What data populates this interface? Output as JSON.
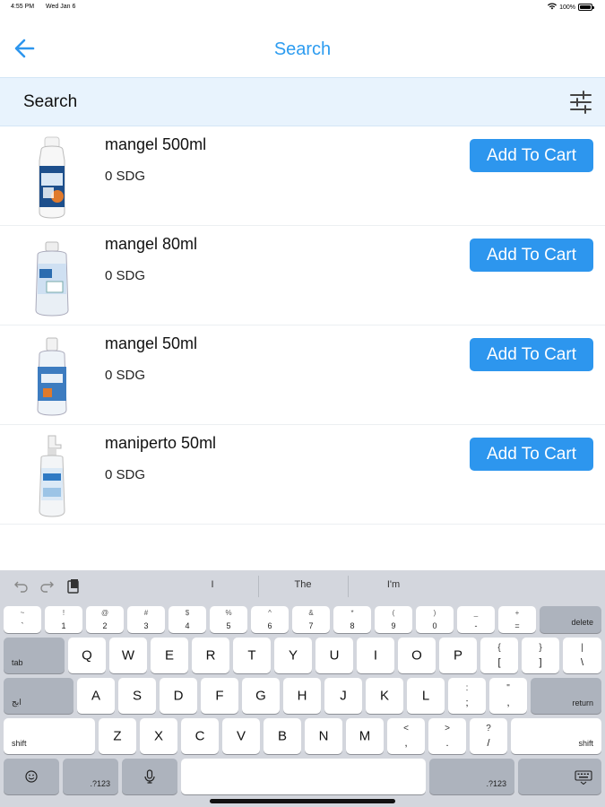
{
  "status_bar": {
    "time": "4:55 PM",
    "date": "Wed Jan 6",
    "battery": "100%"
  },
  "nav": {
    "title": "Search",
    "back_icon": "arrow-left-icon"
  },
  "search": {
    "placeholder": "Search",
    "value": "",
    "filter_icon": "sliders-icon"
  },
  "accent_color": "#2d96ee",
  "products": [
    {
      "name": "mangel 500ml",
      "price": "0 SDG",
      "button": "Add To Cart"
    },
    {
      "name": "mangel 80ml",
      "price": "0 SDG",
      "button": "Add To Cart"
    },
    {
      "name": "mangel 50ml",
      "price": "0 SDG",
      "button": "Add To Cart"
    },
    {
      "name": "maniperto 50ml",
      "price": "0 SDG",
      "button": "Add To Cart"
    }
  ],
  "keyboard": {
    "suggestions": [
      "I",
      "The",
      "I'm"
    ],
    "number_row": [
      {
        "top": "~",
        "bottom": "`"
      },
      {
        "top": "!",
        "bottom": "1"
      },
      {
        "top": "@",
        "bottom": "2"
      },
      {
        "top": "#",
        "bottom": "3"
      },
      {
        "top": "$",
        "bottom": "4"
      },
      {
        "top": "%",
        "bottom": "5"
      },
      {
        "top": "^",
        "bottom": "6"
      },
      {
        "top": "&",
        "bottom": "7"
      },
      {
        "top": "*",
        "bottom": "8"
      },
      {
        "top": "(",
        "bottom": "9"
      },
      {
        "top": ")",
        "bottom": "0"
      },
      {
        "top": "_",
        "bottom": "-"
      },
      {
        "top": "+",
        "bottom": "="
      }
    ],
    "delete": "delete",
    "tab": "tab",
    "row_q": [
      "Q",
      "W",
      "E",
      "R",
      "T",
      "Y",
      "U",
      "I",
      "O",
      "P"
    ],
    "row_q_sym": [
      {
        "top": "{",
        "bottom": "["
      },
      {
        "top": "}",
        "bottom": "]"
      },
      {
        "top": "|",
        "bottom": "\\"
      }
    ],
    "lang": "ابج",
    "row_a": [
      "A",
      "S",
      "D",
      "F",
      "G",
      "H",
      "J",
      "K",
      "L"
    ],
    "row_a_sym": [
      {
        "top": ":",
        "bottom": ";"
      },
      {
        "top": "\"",
        "bottom": ","
      }
    ],
    "return": "return",
    "shift": "shift",
    "row_z": [
      "Z",
      "X",
      "C",
      "V",
      "B",
      "N",
      "M"
    ],
    "row_z_sym": [
      {
        "top": "<",
        "bottom": ","
      },
      {
        "top": ">",
        "bottom": "."
      },
      {
        "top": "?",
        "bottom": "/"
      }
    ],
    "numbers_key": ".?123",
    "emoji_icon": "smiley-icon",
    "mic_icon": "microphone-icon",
    "dismiss_icon": "keyboard-dismiss-icon"
  }
}
